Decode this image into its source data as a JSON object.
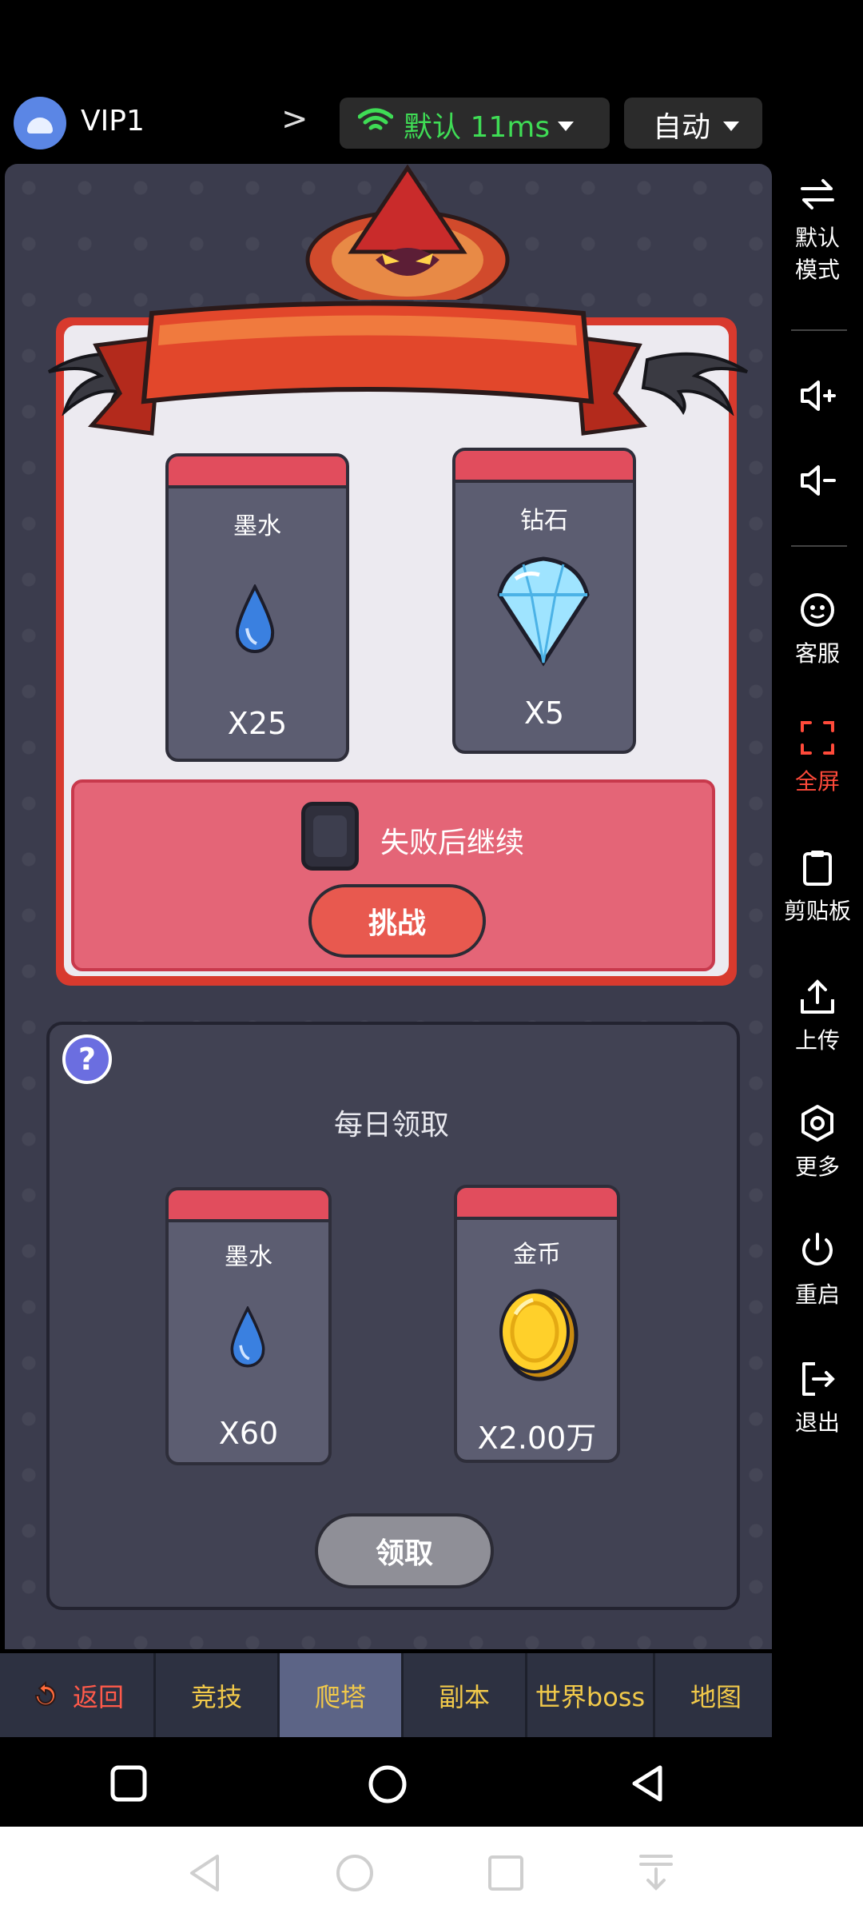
{
  "topbar": {
    "vip_label": "VIP1",
    "network_label": "默认 11ms",
    "mode_label": "自动",
    "accent_green": "#3fdc55"
  },
  "challenge": {
    "rewards": [
      {
        "title": "墨水",
        "qty": "X25",
        "icon": "ink-drop-icon"
      },
      {
        "title": "钻石",
        "qty": "X5",
        "icon": "diamond-icon"
      }
    ],
    "continue_label": "失败后继续",
    "continue_checked": false,
    "challenge_button": "挑战"
  },
  "daily": {
    "help_icon": "?",
    "title": "每日领取",
    "rewards": [
      {
        "title": "墨水",
        "qty": "X60",
        "icon": "ink-drop-icon"
      },
      {
        "title": "金币",
        "qty": "X2.00万",
        "icon": "gold-coin-icon"
      }
    ],
    "claim_button": "领取"
  },
  "nav": {
    "items": [
      {
        "label": "返回",
        "active": false
      },
      {
        "label": "竞技",
        "active": false
      },
      {
        "label": "爬塔",
        "active": true
      },
      {
        "label": "副本",
        "active": false
      },
      {
        "label": "世界boss",
        "active": false
      },
      {
        "label": "地图",
        "active": false
      }
    ]
  },
  "sidebar": {
    "mode_line1": "默认",
    "mode_line2": "模式",
    "support": "客服",
    "fullscreen": "全屏",
    "clipboard": "剪贴板",
    "upload": "上传",
    "more": "更多",
    "restart": "重启",
    "exit": "退出",
    "fullscreen_color": "#ff4a3a"
  }
}
